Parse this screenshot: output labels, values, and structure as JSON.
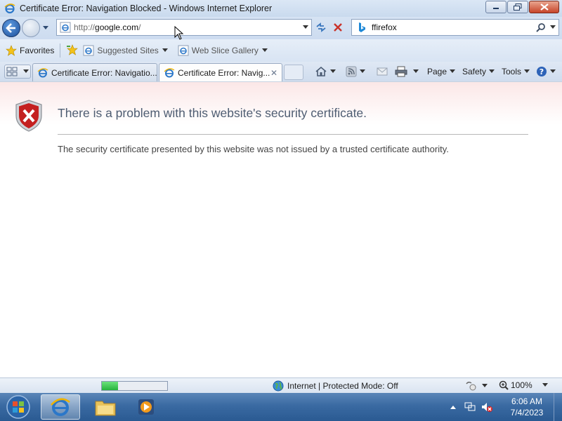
{
  "window": {
    "title": "Certificate Error: Navigation Blocked - Windows Internet Explorer"
  },
  "address_bar": {
    "url_prefix": "http://",
    "url_host": "google.com",
    "url_suffix": "/"
  },
  "search": {
    "value": "ffirefox"
  },
  "favorites_bar": {
    "favorites_label": "Favorites",
    "items": [
      "Suggested Sites",
      "Web Slice Gallery"
    ]
  },
  "tabs": [
    {
      "label": "Certificate Error: Navigatio...",
      "active": false
    },
    {
      "label": "Certificate Error: Navig...",
      "active": true
    }
  ],
  "command_bar": {
    "page_label": "Page",
    "safety_label": "Safety",
    "tools_label": "Tools"
  },
  "content": {
    "headline": "There is a problem with this website's security certificate.",
    "description": "The security certificate presented by this website was not issued by a trusted certificate authority."
  },
  "status_bar": {
    "zone": "Internet | Protected Mode: Off",
    "zoom": "100%",
    "progress": 0.25
  },
  "taskbar": {
    "time": "6:06 AM",
    "date": "7/4/2023"
  },
  "colors": {
    "taskbar": "#3a6aa2",
    "shield_red": "#c42020",
    "headline": "#4e5d72"
  }
}
